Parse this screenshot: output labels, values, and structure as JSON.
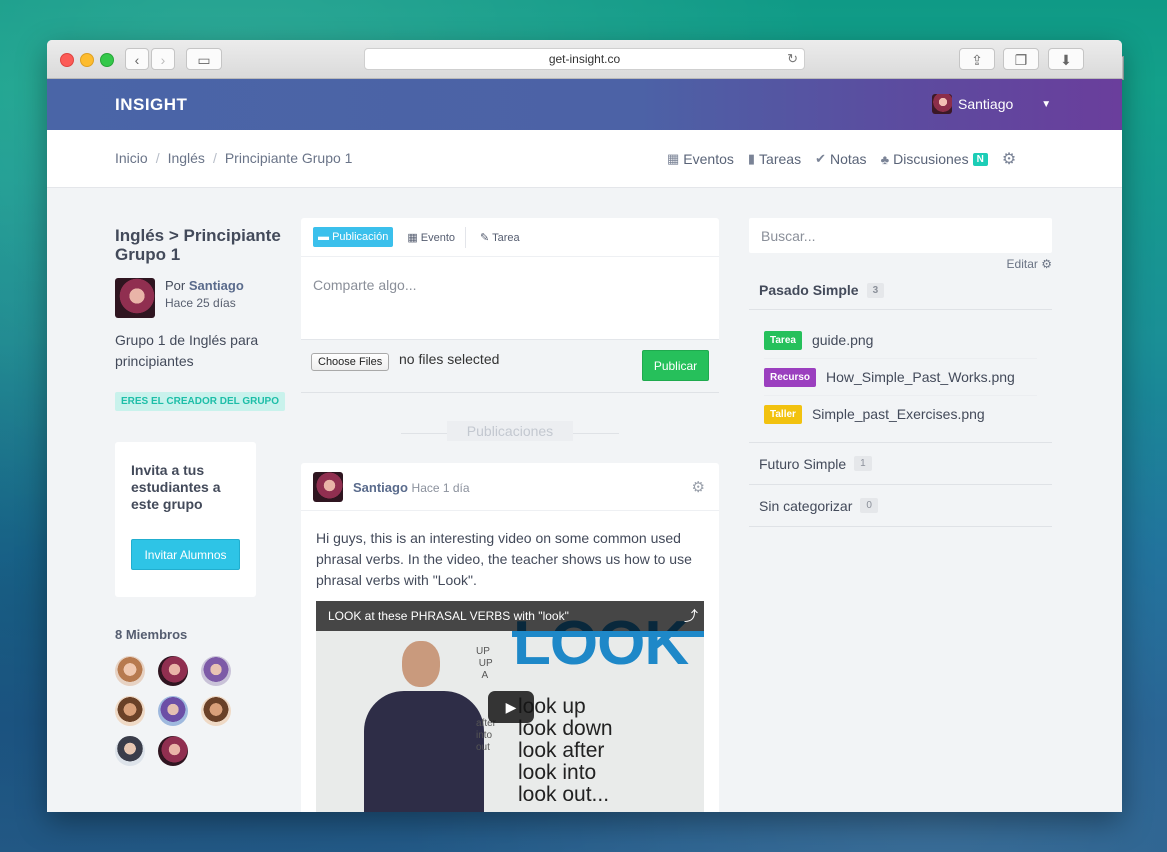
{
  "browser": {
    "url": "get-insight.co",
    "new_tab": "+"
  },
  "app": {
    "brand": "INSIGHT",
    "user_name": "Santiago"
  },
  "breadcrumb": [
    "Inicio",
    "Inglés",
    "Principiante Grupo 1"
  ],
  "breadcrumb_sep": "/",
  "nav": {
    "events": "Eventos",
    "tasks": "Tareas",
    "notes": "Notas",
    "discussions": "Discusiones",
    "discussions_badge": "N"
  },
  "group": {
    "title": "Inglés > Principiante Grupo 1",
    "by_prefix": "Por",
    "author": "Santiago",
    "date": "Hace 25 días",
    "description": "Grupo 1 de Inglés para principiantes",
    "creator_badge": "ERES EL CREADOR DEL GRUPO"
  },
  "invite": {
    "title": "Invita a tus estudiantes a este grupo",
    "button": "Invitar Alumnos"
  },
  "members": {
    "title": "8 Miembros",
    "count": 8
  },
  "composer": {
    "tab_post": "Publicación",
    "tab_event": "Evento",
    "tab_task": "Tarea",
    "placeholder": "Comparte algo...",
    "choose_files": "Choose Files",
    "no_files": "no files selected",
    "publish": "Publicar"
  },
  "feed": {
    "divider": "Publicaciones"
  },
  "post": {
    "author": "Santiago",
    "date": "Hace 1 día",
    "text": "Hi guys, this is an interesting video on some common used phrasal verbs. In the video, the teacher shows us how to use phrasal verbs with \"Look\".",
    "video_title": "LOOK at these PHRASAL VERBS with \"look\"",
    "video_banner": "LOOK",
    "video_lines": [
      "look up",
      "look down",
      "look after",
      "look into",
      "look out..."
    ]
  },
  "sidebar": {
    "search_placeholder": "Buscar...",
    "edit": "Editar",
    "categories": [
      {
        "name": "Pasado Simple",
        "count": "3"
      },
      {
        "name": "Futuro Simple",
        "count": "1"
      },
      {
        "name": "Sin categorizar",
        "count": "0"
      }
    ],
    "resources": [
      {
        "tag": "Tarea",
        "tag_color": "#26c05b",
        "file": "guide.png"
      },
      {
        "tag": "Recurso",
        "tag_color": "#9b3fbf",
        "file": "How_Simple_Past_Works.png"
      },
      {
        "tag": "Taller",
        "tag_color": "#f2c20f",
        "file": "Simple_past_Exercises.png"
      }
    ]
  },
  "colors": {
    "header_start": "#4a65a7",
    "header_end": "#6a3e9c",
    "accent_teal": "#1ccdb6",
    "publish_green": "#26c05b",
    "invite_blue": "#2ec4e6"
  }
}
